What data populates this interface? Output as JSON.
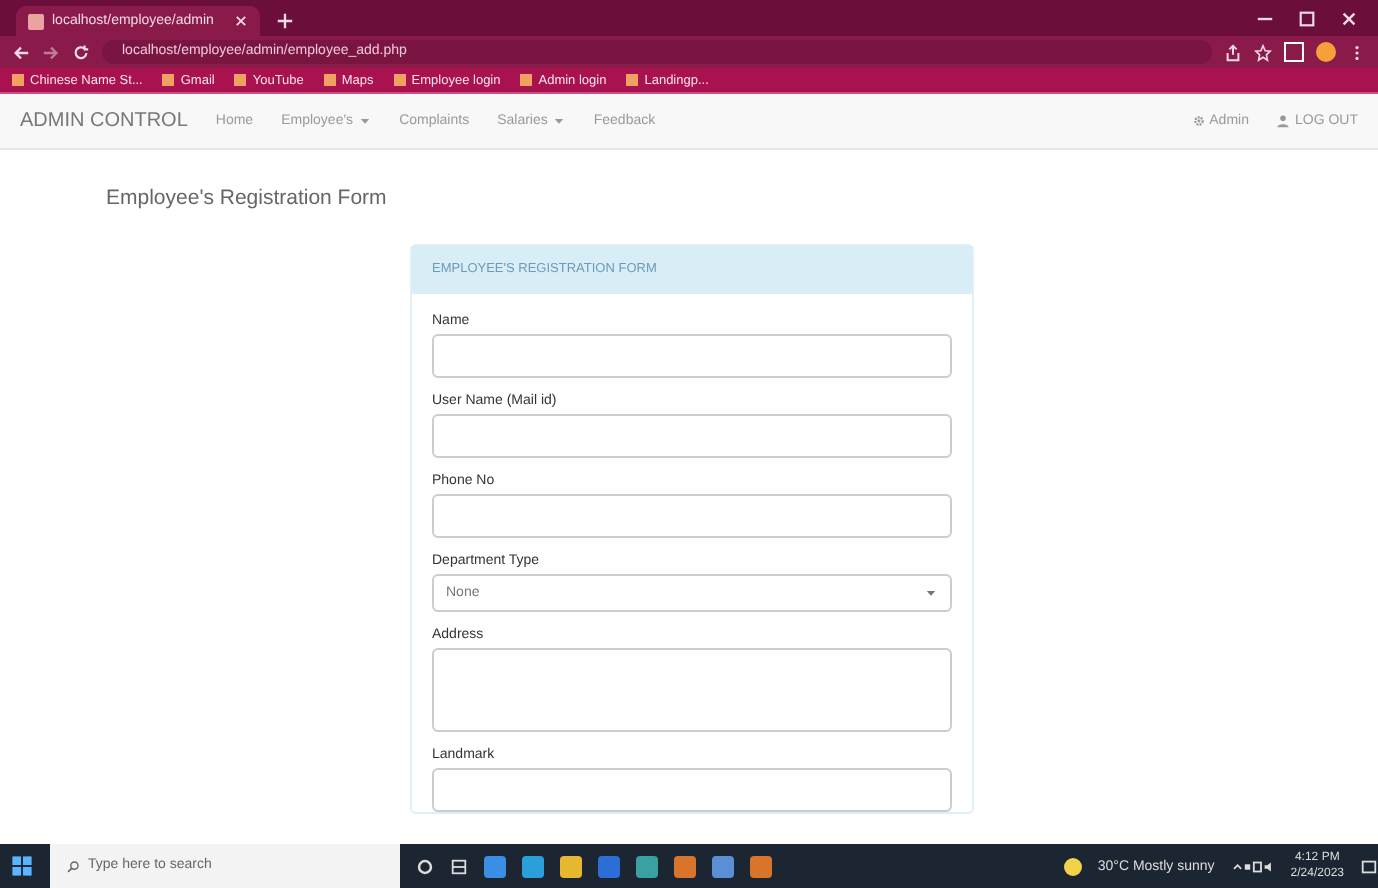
{
  "browser": {
    "tab_title": "localhost/employee/admin",
    "url": "localhost/employee/admin/employee_add.php",
    "bookmarks": [
      "Chinese Name St...",
      "Gmail",
      "YouTube",
      "Maps",
      "Employee login",
      "Admin login",
      "Landingp..."
    ]
  },
  "navbar": {
    "brand": "ADMIN CONTROL",
    "items": [
      {
        "label": "Home",
        "dropdown": false
      },
      {
        "label": "Employee's",
        "dropdown": true
      },
      {
        "label": "Complaints",
        "dropdown": false
      },
      {
        "label": "Salaries",
        "dropdown": true
      },
      {
        "label": "Feedback",
        "dropdown": false
      }
    ],
    "right_items": [
      {
        "label": "Admin",
        "kind": "gear"
      },
      {
        "label": "LOG OUT",
        "kind": "user"
      }
    ]
  },
  "page_title": "Employee's Registration Form",
  "form": {
    "heading": "EMPLOYEE'S REGISTRATION FORM",
    "fields": [
      {
        "label": "Name",
        "kind": "text"
      },
      {
        "label": "User Name (Mail id)",
        "kind": "text"
      },
      {
        "label": "Phone No",
        "kind": "text"
      },
      {
        "label": "Department Type",
        "kind": "select",
        "value": "None"
      },
      {
        "label": "Address",
        "kind": "textarea"
      },
      {
        "label": "Landmark",
        "kind": "text"
      }
    ]
  },
  "taskbar": {
    "search_placeholder": "Type here to search",
    "weather": "30°C Mostly sunny",
    "time": "4:12 PM",
    "date": "2/24/2023"
  }
}
